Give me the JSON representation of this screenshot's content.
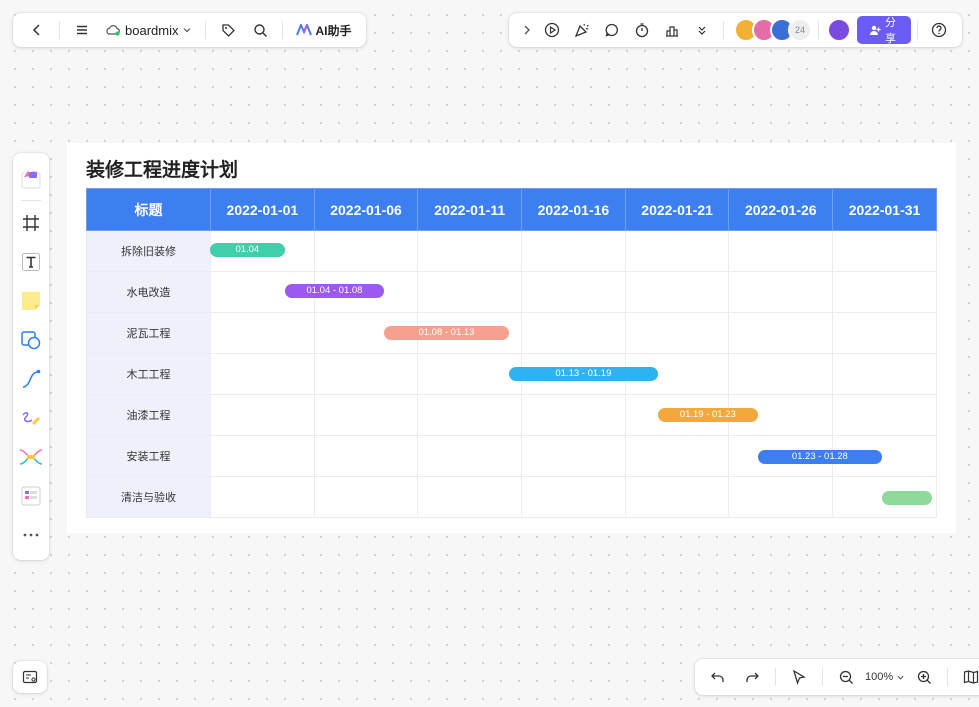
{
  "toolbar_left": {
    "brand": "boardmix",
    "ai_label": "AI助手"
  },
  "toolbar_right": {
    "collaborator_count": "24",
    "share_label": "分享"
  },
  "zoom": {
    "level": "100%"
  },
  "board": {
    "title": "装修工程进度计划",
    "header_first": "标题",
    "dates": [
      "2022-01-01",
      "2022-01-06",
      "2022-01-11",
      "2022-01-16",
      "2022-01-21",
      "2022-01-26",
      "2022-01-31"
    ],
    "tasks": [
      {
        "name": "拆除旧装修",
        "label": "01.04",
        "start": 0,
        "end": 0.72,
        "color": "#3fcfaa"
      },
      {
        "name": "水电改造",
        "label": "01.04 - 01.08",
        "start": 0.72,
        "end": 1.68,
        "color": "#9b59f0"
      },
      {
        "name": "泥瓦工程",
        "label": "01.08 - 01.13",
        "start": 1.68,
        "end": 2.88,
        "color": "#f7a08f"
      },
      {
        "name": "木工工程",
        "label": "01.13 - 01.19",
        "start": 2.88,
        "end": 4.32,
        "color": "#2db3f0"
      },
      {
        "name": "油漆工程",
        "label": "01.19 - 01.23",
        "start": 4.32,
        "end": 5.28,
        "color": "#f2a93b"
      },
      {
        "name": "安装工程",
        "label": "01.23 - 01.28",
        "start": 5.28,
        "end": 6.48,
        "color": "#3d7ef0"
      },
      {
        "name": "清洁与验收",
        "label": "",
        "start": 6.48,
        "end": 6.96,
        "color": "#8fd99a"
      }
    ]
  }
}
